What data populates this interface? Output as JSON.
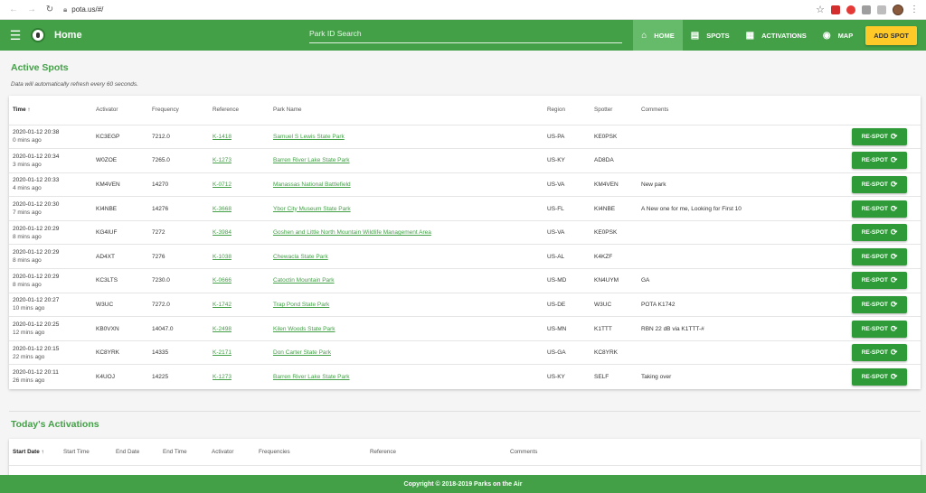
{
  "browser": {
    "url": "pota.us/#/"
  },
  "header": {
    "title": "Home",
    "search_placeholder": "Park ID Search",
    "nav": [
      {
        "label": "HOME",
        "icon": "home-icon"
      },
      {
        "label": "SPOTS",
        "icon": "clipboard-icon"
      },
      {
        "label": "ACTIVATIONS",
        "icon": "calendar-icon"
      },
      {
        "label": "MAP",
        "icon": "globe-icon"
      }
    ],
    "add_spot": "ADD SPOT"
  },
  "active_spots": {
    "title": "Active Spots",
    "note": "Data will automatically refresh every 60 seconds.",
    "columns": [
      "Time",
      "Activator",
      "Frequency",
      "Reference",
      "Park Name",
      "Region",
      "Spotter",
      "Comments"
    ],
    "respot_label": "RE-SPOT",
    "rows": [
      {
        "time": "2020-01-12 20:38",
        "ago": "0 mins ago",
        "activator": "KC3EGP",
        "frequency": "7212.0",
        "reference": "K-1418",
        "park": "Samuel S Lewis State Park",
        "region": "US-PA",
        "spotter": "KE0PSK",
        "comments": ""
      },
      {
        "time": "2020-01-12 20:34",
        "ago": "3 mins ago",
        "activator": "W0ZOE",
        "frequency": "7265.0",
        "reference": "K-1273",
        "park": "Barren River Lake State Park",
        "region": "US-KY",
        "spotter": "AD8DA",
        "comments": ""
      },
      {
        "time": "2020-01-12 20:33",
        "ago": "4 mins ago",
        "activator": "KM4VEN",
        "frequency": "14270",
        "reference": "K-0712",
        "park": "Manassas National Battlefield",
        "region": "US-VA",
        "spotter": "KM4VEN",
        "comments": "New park"
      },
      {
        "time": "2020-01-12 20:30",
        "ago": "7 mins ago",
        "activator": "KI4NBE",
        "frequency": "14276",
        "reference": "K-3668",
        "park": "Ybor City Museum State Park",
        "region": "US-FL",
        "spotter": "KI4NBE",
        "comments": "A New one for me, Looking for First 10"
      },
      {
        "time": "2020-01-12 20:29",
        "ago": "8 mins ago",
        "activator": "KG4IUF",
        "frequency": "7272",
        "reference": "K-3984",
        "park": "Goshen and Little North Mountain Wildlife Management Area",
        "region": "US-VA",
        "spotter": "KE0PSK",
        "comments": ""
      },
      {
        "time": "2020-01-12 20:29",
        "ago": "8 mins ago",
        "activator": "AD4XT",
        "frequency": "7276",
        "reference": "K-1038",
        "park": "Chewacla State Park",
        "region": "US-AL",
        "spotter": "K4KZF",
        "comments": ""
      },
      {
        "time": "2020-01-12 20:29",
        "ago": "8 mins ago",
        "activator": "KC3LTS",
        "frequency": "7230.0",
        "reference": "K-0666",
        "park": "Catoctin Mountain Park",
        "region": "US-MD",
        "spotter": "KN4UYM",
        "comments": "GA"
      },
      {
        "time": "2020-01-12 20:27",
        "ago": "10 mins ago",
        "activator": "W3UC",
        "frequency": "7272.0",
        "reference": "K-1742",
        "park": "Trap Pond State Park",
        "region": "US-DE",
        "spotter": "W3UC",
        "comments": "POTA K1742"
      },
      {
        "time": "2020-01-12 20:25",
        "ago": "12 mins ago",
        "activator": "KB0VXN",
        "frequency": "14047.0",
        "reference": "K-2498",
        "park": "Kilen Woods State Park",
        "region": "US-MN",
        "spotter": "K1TTT",
        "comments": "RBN 22 dB via K1TTT-#"
      },
      {
        "time": "2020-01-12 20:15",
        "ago": "22 mins ago",
        "activator": "KC8YRK",
        "frequency": "14335",
        "reference": "K-2171",
        "park": "Don Carter State Park",
        "region": "US-GA",
        "spotter": "KC8YRK",
        "comments": ""
      },
      {
        "time": "2020-01-12 20:11",
        "ago": "26 mins ago",
        "activator": "K4UOJ",
        "frequency": "14225",
        "reference": "K-1273",
        "park": "Barren River Lake State Park",
        "region": "US-KY",
        "spotter": "SELF",
        "comments": "Taking over"
      }
    ]
  },
  "activations": {
    "title": "Today's Activations",
    "columns": [
      "Start Date",
      "Start Time",
      "End Date",
      "End Time",
      "Activator",
      "Frequencies",
      "Reference",
      "Comments"
    ]
  },
  "footer": {
    "text": "Copyright © 2018-2019 Parks on the Air"
  }
}
